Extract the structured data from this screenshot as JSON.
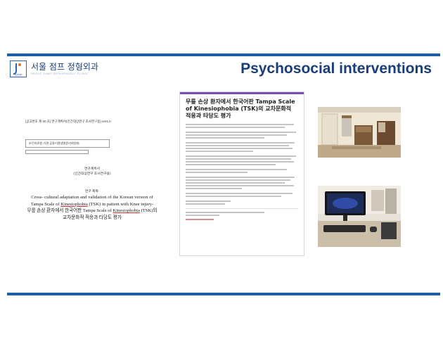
{
  "header": {
    "logo_name": "서울 점프 정형외과",
    "logo_sub": "SEOUL JUMP ORTHOPAEDIC CLINIC",
    "logo_mark": "SJMP",
    "title": "Psychosocial interventions"
  },
  "left_document": {
    "top_line": "[공고번호 제 00 호] 연구계획서(인간대상연구 조사연구용) ver1.0",
    "box1": "보건의료원 기관 공용기관생명윤리위원회",
    "box2": "",
    "label1": "연구계획서",
    "label2": "(인간대상연구 조사연구용)",
    "label3": "연구 제목:",
    "title_en_1": "Cross- cultural adaptation and validation of the Korean version of",
    "title_en_2_pre": "Tampa Scale of ",
    "title_en_2_kw": "Kinesiophobia",
    "title_en_2_post": " (TSK) in patient with Knee injury-",
    "title_ko_1_pre": "무릎 손상 환자에서 한국어판 Tampa Scale of ",
    "title_ko_1_kw": "Kinesiophobia",
    "title_ko_1_post": " (TSK)의",
    "title_ko_2": "교차문화적 적응과 타당도 평가"
  },
  "middle_document": {
    "title": "무릎 손상 환자에서 한국어판 Tampa Scale of Kinesiophobia (TSK)의 교차문화적 적응과 타당도 평가"
  },
  "photos": {
    "room": "clinic-room-photo",
    "desk": "computer-desk-photo"
  },
  "colors": {
    "accent_bar": "#1f5fa8",
    "heading": "#1a3e7a",
    "doc_top_bar": "#7a4fb3"
  }
}
